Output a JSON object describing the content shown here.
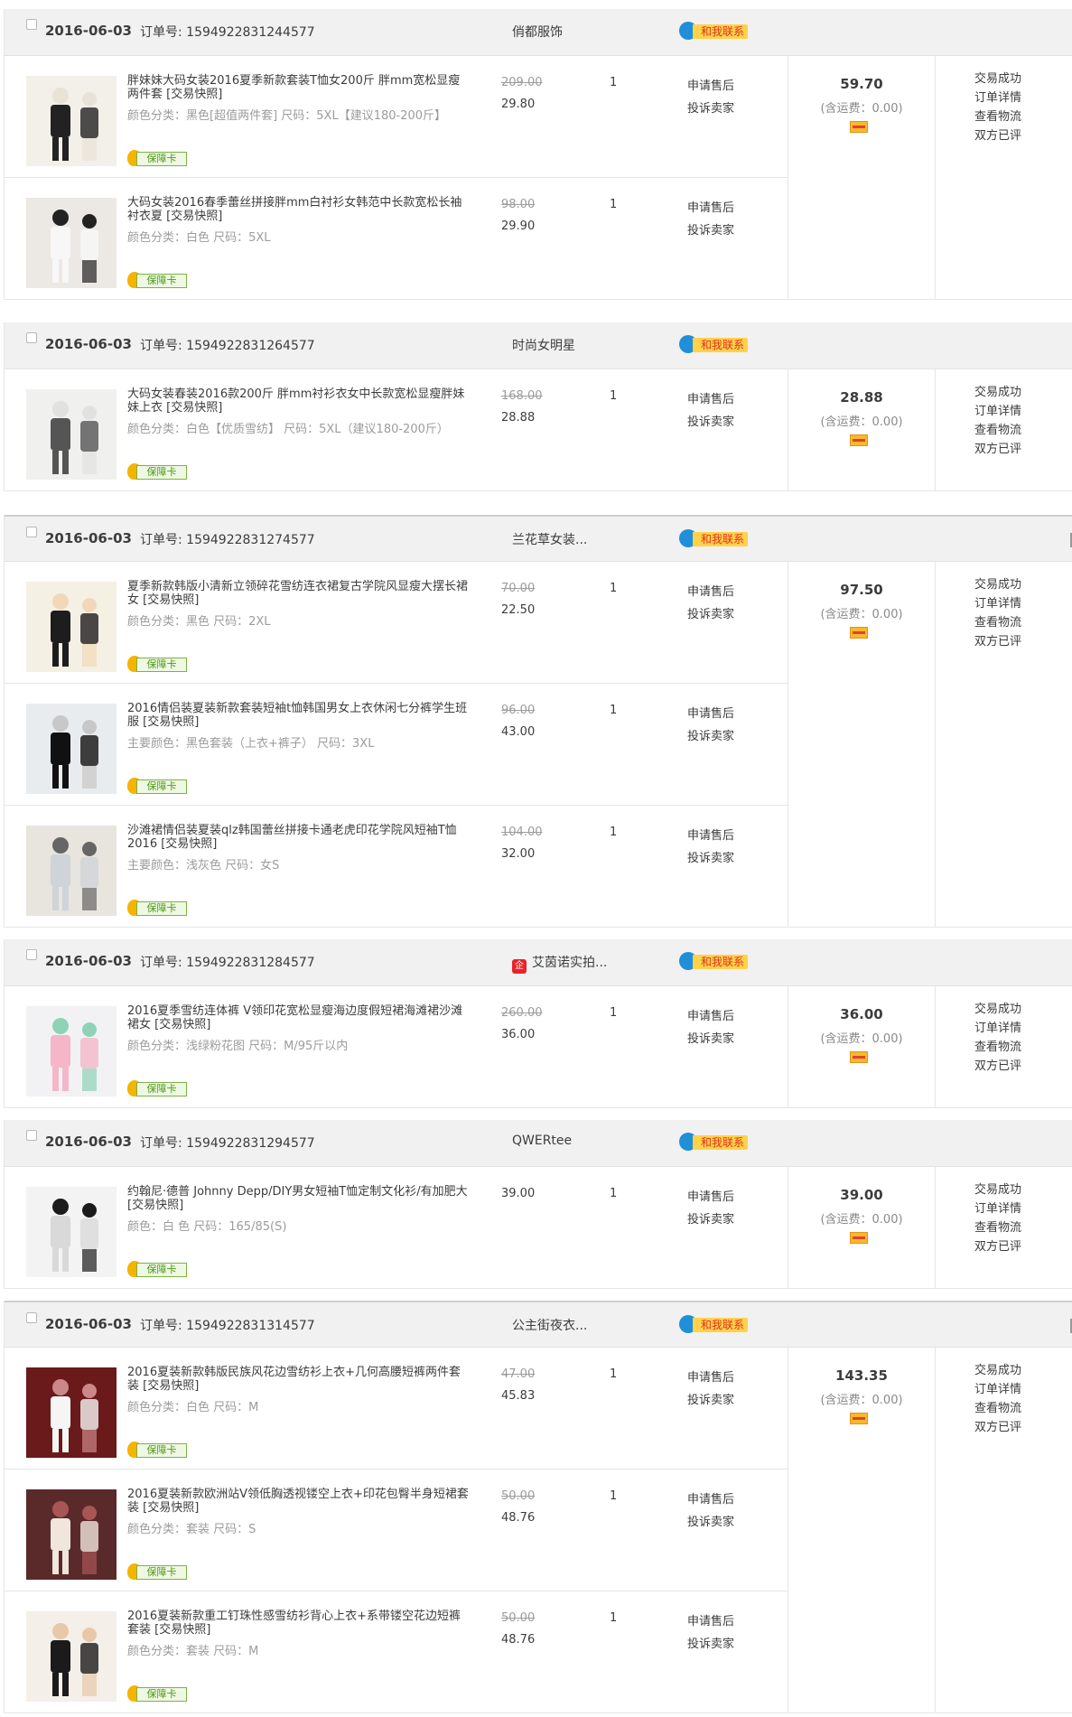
{
  "labels": {
    "order_no_prefix": "订单号: ",
    "contact_label": "和我联系",
    "guarantee_label": "保障卡",
    "refund_link": "申请售后",
    "complaint_link": "投诉卖家",
    "shipping_text": "(含运费：0.00)",
    "status_success": "交易成功",
    "order_detail_link": "订单详情",
    "logistics_link": "查看物流",
    "review_status": "双方已评"
  },
  "orders": [
    {
      "date": "2016-06-03",
      "order_no": "1594922831244577",
      "shop": "俏都服饰",
      "shop_icon": "",
      "total": "59.70",
      "products": [
        {
          "title": "胖妹妹大码女装2016夏季新款套装T恤女200斤 胖mm宽松显瘦两件套 [交易快照]",
          "attr": "颜色分类：黑色[超值两件套]   尺码：5XL【建议180-200斤】",
          "orig_price": "209.00",
          "price": "29.80",
          "qty": "1"
        },
        {
          "title": "大码女装2016春季蕾丝拼接胖mm白衬衫女韩范中长款宽松长袖衬衣夏 [交易快照]",
          "attr": "颜色分类：白色   尺码：5XL",
          "orig_price": "98.00",
          "price": "29.90",
          "qty": "1"
        }
      ]
    },
    {
      "date": "2016-06-03",
      "order_no": "1594922831264577",
      "shop": "时尚女明星",
      "shop_icon": "",
      "total": "28.88",
      "products": [
        {
          "title": "大码女装春装2016款200斤 胖mm衬衫衣女中长款宽松显瘦胖妹妹上衣 [交易快照]",
          "attr": "颜色分类：白色【优质雪纺】   尺码：5XL（建议180-200斤）",
          "orig_price": "168.00",
          "price": "28.88",
          "qty": "1"
        }
      ]
    },
    {
      "date": "2016-06-03",
      "order_no": "1594922831274577",
      "shop": "兰花草女装...",
      "shop_icon": "",
      "total": "97.50",
      "products": [
        {
          "title": "夏季新款韩版小清新立领碎花雪纺连衣裙复古学院风显瘦大摆长裙女 [交易快照]",
          "attr": "颜色分类：黑色   尺码：2XL",
          "orig_price": "70.00",
          "price": "22.50",
          "qty": "1"
        },
        {
          "title": "2016情侣装夏装新款套装短袖t恤韩国男女上衣休闲七分裤学生班服 [交易快照]",
          "attr": "主要颜色：黑色套装（上衣+裤子）   尺码：3XL",
          "orig_price": "96.00",
          "price": "43.00",
          "qty": "1"
        },
        {
          "title": "沙滩裙情侣装夏装qlz韩国蕾丝拼接卡通老虎印花学院风短袖T恤2016 [交易快照]",
          "attr": "主要颜色：浅灰色   尺码：女S",
          "orig_price": "104.00",
          "price": "32.00",
          "qty": "1"
        }
      ]
    },
    {
      "date": "2016-06-03",
      "order_no": "1594922831284577",
      "shop": "艾茵诺实拍...",
      "shop_icon": "企",
      "total": "36.00",
      "products": [
        {
          "title": "2016夏季雪纺连体裤 V领印花宽松显瘦海边度假短裙海滩裙沙滩裙女 [交易快照]",
          "attr": "颜色分类：浅绿粉花图   尺码：M/95斤以内",
          "orig_price": "260.00",
          "price": "36.00",
          "qty": "1"
        }
      ]
    },
    {
      "date": "2016-06-03",
      "order_no": "1594922831294577",
      "shop": "QWERtee",
      "shop_icon": "",
      "total": "39.00",
      "products": [
        {
          "title": "约翰尼·德普 Johnny Depp/DIY男女短袖T恤定制文化衫/有加肥大 [交易快照]",
          "attr": "颜色：白 色   尺码：165/85(S)",
          "orig_price": "",
          "price": "39.00",
          "qty": "1"
        }
      ]
    },
    {
      "date": "2016-06-03",
      "order_no": "1594922831314577",
      "shop": "公主街夜衣...",
      "shop_icon": "",
      "total": "143.35",
      "products": [
        {
          "title": "2016夏装新款韩版民族风花边雪纺衫上衣+几何高腰短裤两件套装 [交易快照]",
          "attr": "颜色分类：白色   尺码：M",
          "orig_price": "47.00",
          "price": "45.83",
          "qty": "1"
        },
        {
          "title": "2016夏装新款欧洲站V领低胸透视镂空上衣+印花包臀半身短裙套装 [交易快照]",
          "attr": "颜色分类：套装   尺码：S",
          "orig_price": "50.00",
          "price": "48.76",
          "qty": "1"
        },
        {
          "title": "2016夏装新款重工钉珠性感雪纺衫背心上衣+系带镂空花边短裤套装 [交易快照]",
          "attr": "颜色分类：套装   尺码：M",
          "orig_price": "50.00",
          "price": "48.76",
          "qty": "1"
        }
      ]
    }
  ]
}
